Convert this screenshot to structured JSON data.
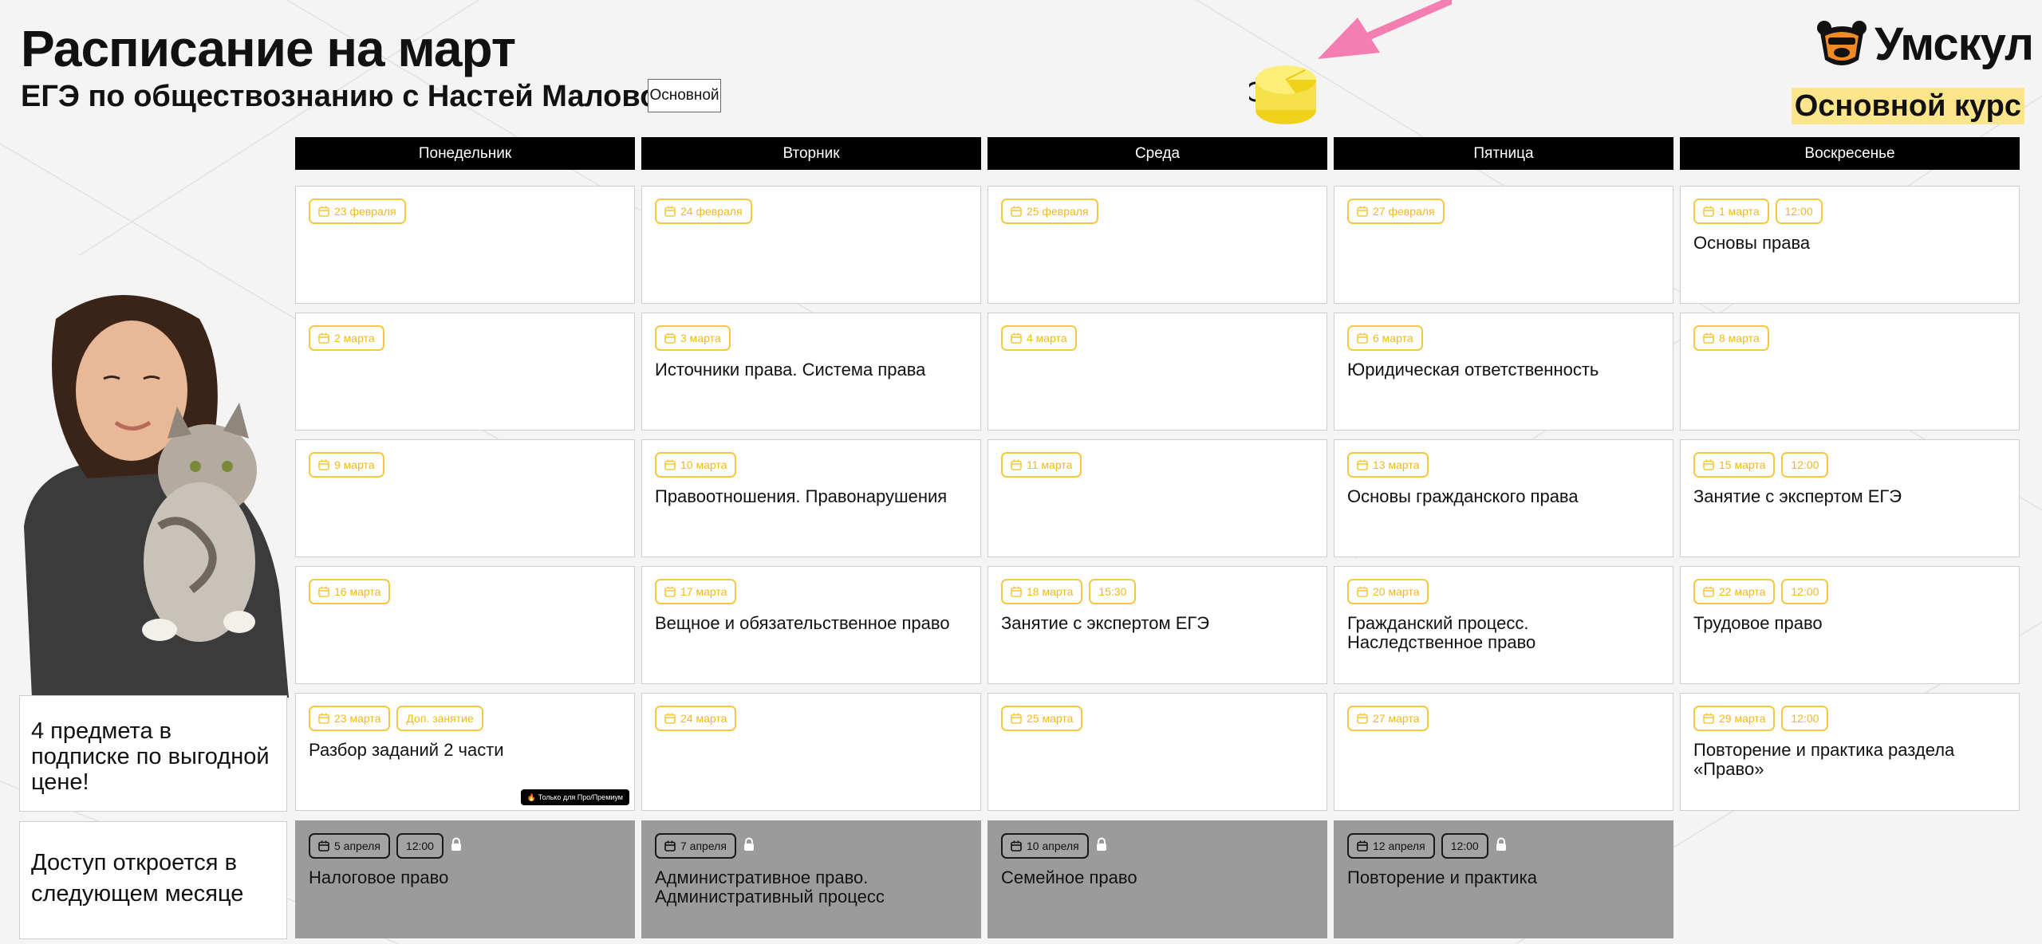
{
  "title": "Расписание на март",
  "subtitle": "ЕГЭ по обществознанию с Настей Маловой",
  "tag_button": "Основной",
  "logo": {
    "name": "Умскул",
    "icon": "bear-icon"
  },
  "course_label": "Основной курс",
  "days": [
    "Понедельник",
    "Вторник",
    "Среда",
    "Пятница",
    "Воскресенье"
  ],
  "colors": {
    "accent": "#f5c842",
    "highlight": "#fce58b",
    "locked": "#9b9b9b",
    "arrow": "#f47eb1"
  },
  "weeks": [
    [
      {
        "date": "23 февраля"
      },
      {
        "date": "24 февраля"
      },
      {
        "date": "25 февраля"
      },
      {
        "date": "27 февраля"
      },
      {
        "date": "1 марта",
        "time": "12:00",
        "title": "Основы права"
      }
    ],
    [
      {
        "date": "2 марта"
      },
      {
        "date": "3 марта",
        "title": "Источники права. Система права"
      },
      {
        "date": "4 марта"
      },
      {
        "date": "6 марта",
        "title": "Юридическая ответственность"
      },
      {
        "date": "8 марта"
      }
    ],
    [
      {
        "date": "9 марта"
      },
      {
        "date": "10 марта",
        "title": "Правоотношения. Правонарушения"
      },
      {
        "date": "11 марта"
      },
      {
        "date": "13 марта",
        "title": "Основы гражданского права"
      },
      {
        "date": "15 марта",
        "time": "12:00",
        "title": "Занятие с экспертом ЕГЭ"
      }
    ],
    [
      {
        "date": "16 марта"
      },
      {
        "date": "17 марта",
        "title": "Вещное и обязательственное право"
      },
      {
        "date": "18 марта",
        "time": "15:30",
        "title": "Занятие с экспертом ЕГЭ"
      },
      {
        "date": "20 марта",
        "title": "Гражданский процесс. Наследственное право"
      },
      {
        "date": "22 марта",
        "time": "12:00",
        "title": "Трудовое право"
      }
    ],
    [
      {
        "date": "23 марта",
        "extra": "Доп. занятие",
        "title": "Разбор заданий 2 части",
        "premium": "Только для Про/Премиум"
      },
      {
        "date": "24 марта"
      },
      {
        "date": "25 марта"
      },
      {
        "date": "27 марта"
      },
      {
        "date": "29 марта",
        "time": "12:00",
        "title": "Повторение и практика раздела «Право»"
      }
    ]
  ],
  "locked_row": [
    {
      "date": "5 апреля",
      "time": "12:00",
      "title": "Налоговое право"
    },
    {
      "date": "7 апреля",
      "title": "Административное право. Административный процесс"
    },
    {
      "date": "10 апреля",
      "title": "Семейное право"
    },
    {
      "date": "12 апреля",
      "time": "12:00",
      "title": "Повторение и практика"
    }
  ],
  "promo_text": "4 предмета в подписке по выгодной цене!",
  "access_text": "Доступ откроется в следующем месяце"
}
